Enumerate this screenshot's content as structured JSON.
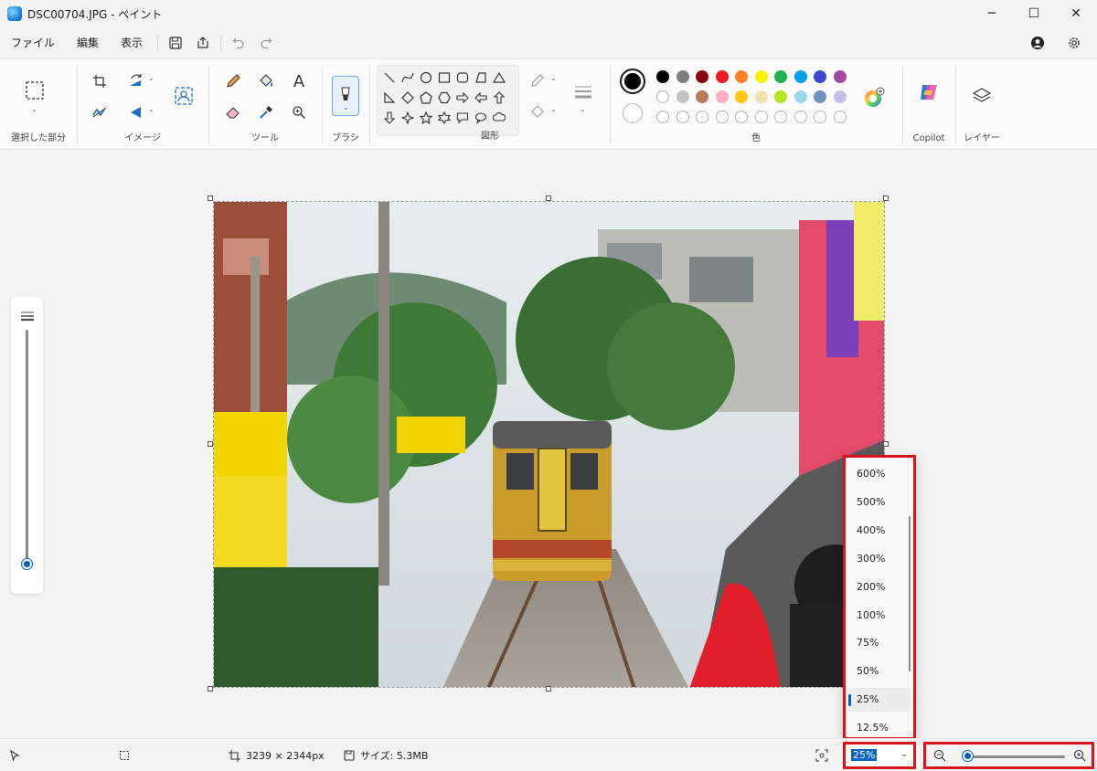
{
  "window": {
    "title": "DSC00704.JPG - ペイント",
    "icon": "paint-app-icon",
    "controls": {
      "minimize": "─",
      "maximize": "☐",
      "close": "✕"
    }
  },
  "menu": {
    "items": [
      "ファイル",
      "編集",
      "表示"
    ],
    "quick_access": [
      "save-icon",
      "share-icon",
      "undo-icon",
      "redo-icon"
    ],
    "right": [
      "account-icon",
      "settings-icon"
    ]
  },
  "ribbon": {
    "groups": {
      "selection": "選択した部分",
      "image": "イメージ",
      "tools": "ツール",
      "brush": "ブラシ",
      "shapes": "図形",
      "colors": "色",
      "copilot": "Copilot",
      "layers": "レイヤー"
    },
    "text_tool_glyph": "A",
    "colors": {
      "primary": "#000000",
      "secondary": "#ffffff",
      "row1": [
        "#000000",
        "#7f7f7f",
        "#880015",
        "#ed1c24",
        "#ff7f27",
        "#fff200",
        "#22b14c",
        "#00a2e8",
        "#3f48cc",
        "#a349a4"
      ],
      "row2": [
        "#ffffff",
        "#c3c3c3",
        "#b97a57",
        "#ffaec9",
        "#ffc90e",
        "#efe4b0",
        "#b5e61d",
        "#99d9ea",
        "#7092be",
        "#c8bfe7"
      ]
    }
  },
  "zoom_menu": {
    "options": [
      "600%",
      "500%",
      "400%",
      "300%",
      "200%",
      "100%",
      "75%",
      "50%",
      "25%",
      "12.5%"
    ],
    "selected": "25%"
  },
  "status": {
    "dimensions": "3239 × 2344px",
    "file_size": "サイズ: 5.3MB",
    "zoom": "25%"
  },
  "brush_size_level": 0.02,
  "zoom_level_fraction": 0.05
}
